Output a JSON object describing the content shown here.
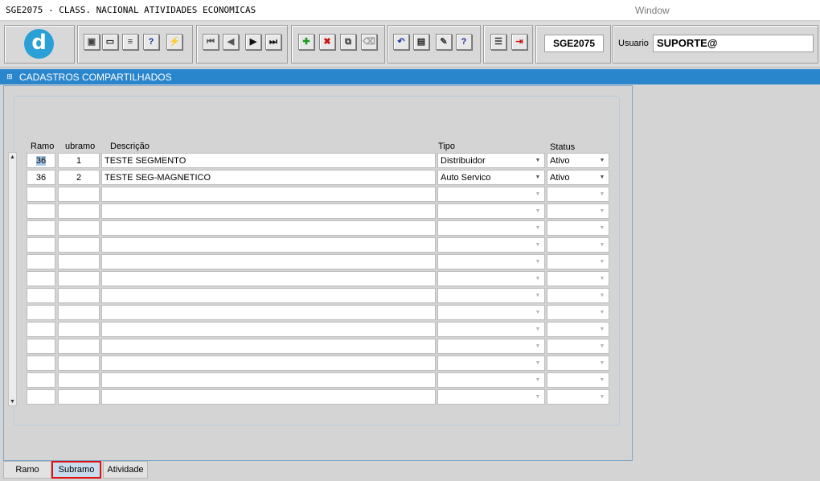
{
  "titlebar": {
    "app_title": "SGE2075 - CLASS. NACIONAL ATIVIDADES ECONOMICAS",
    "window_menu": "Window"
  },
  "toolbar": {
    "logo_glyph": "d",
    "screen_code": "SGE2075",
    "usuario_label": "Usuario",
    "usuario_value": "SUPORTE@",
    "buttons": [
      {
        "name": "save-icon",
        "glyph": "▣",
        "color": "#444444"
      },
      {
        "name": "window-icon",
        "glyph": "▭",
        "color": "#222222"
      },
      {
        "name": "print-icon",
        "glyph": "≡",
        "color": "#333333"
      },
      {
        "name": "query-icon",
        "glyph": "?",
        "color": "#1a2ea0"
      },
      {
        "name": "execute-query-icon",
        "glyph": "⚡",
        "color": "#1a2ea0"
      },
      {
        "name": "first-record-icon",
        "glyph": "⏮",
        "color": "#555555"
      },
      {
        "name": "previous-record-icon",
        "glyph": "◀",
        "color": "#555555"
      },
      {
        "name": "next-record-icon",
        "glyph": "▶",
        "color": "#111111"
      },
      {
        "name": "last-record-icon",
        "glyph": "⏭",
        "color": "#111111"
      },
      {
        "name": "insert-record-icon",
        "glyph": "✚",
        "color": "#1f9a1f"
      },
      {
        "name": "delete-record-icon",
        "glyph": "✖",
        "color": "#cc1010"
      },
      {
        "name": "duplicate-record-icon",
        "glyph": "⧉",
        "color": "#333333"
      },
      {
        "name": "clear-record-icon",
        "glyph": "⌫",
        "color": "#999999"
      },
      {
        "name": "undo-icon",
        "glyph": "↶",
        "color": "#1a2ea0"
      },
      {
        "name": "clipboard-icon",
        "glyph": "▤",
        "color": "#222222"
      },
      {
        "name": "tools-icon",
        "glyph": "✎",
        "color": "#333333"
      },
      {
        "name": "help-icon",
        "glyph": "?",
        "color": "#1a2ea0"
      },
      {
        "name": "menu-icon",
        "glyph": "☰",
        "color": "#333333"
      },
      {
        "name": "exit-icon",
        "glyph": "⇥",
        "color": "#cc1010"
      }
    ]
  },
  "section": {
    "icon": "section-icon",
    "title": "CADASTROS COMPARTILHADOS"
  },
  "grid": {
    "headers": {
      "ramo": "Ramo",
      "subramo": "ubramo",
      "descricao": "Descrição",
      "tipo": "Tipo",
      "status": "Status"
    },
    "rows": [
      {
        "ramo": "36",
        "subramo": "1",
        "descricao": "TESTE SEGMENTO",
        "tipo": "Distribuidor",
        "status": "Ativo"
      },
      {
        "ramo": "36",
        "subramo": "2",
        "descricao": "TESTE SEG-MAGNETICO",
        "tipo": "Auto Servico",
        "status": "Ativo"
      },
      {
        "ramo": "",
        "subramo": "",
        "descricao": "",
        "tipo": "",
        "status": ""
      },
      {
        "ramo": "",
        "subramo": "",
        "descricao": "",
        "tipo": "",
        "status": ""
      },
      {
        "ramo": "",
        "subramo": "",
        "descricao": "",
        "tipo": "",
        "status": ""
      },
      {
        "ramo": "",
        "subramo": "",
        "descricao": "",
        "tipo": "",
        "status": ""
      },
      {
        "ramo": "",
        "subramo": "",
        "descricao": "",
        "tipo": "",
        "status": ""
      },
      {
        "ramo": "",
        "subramo": "",
        "descricao": "",
        "tipo": "",
        "status": ""
      },
      {
        "ramo": "",
        "subramo": "",
        "descricao": "",
        "tipo": "",
        "status": ""
      },
      {
        "ramo": "",
        "subramo": "",
        "descricao": "",
        "tipo": "",
        "status": ""
      },
      {
        "ramo": "",
        "subramo": "",
        "descricao": "",
        "tipo": "",
        "status": ""
      },
      {
        "ramo": "",
        "subramo": "",
        "descricao": "",
        "tipo": "",
        "status": ""
      },
      {
        "ramo": "",
        "subramo": "",
        "descricao": "",
        "tipo": "",
        "status": ""
      },
      {
        "ramo": "",
        "subramo": "",
        "descricao": "",
        "tipo": "",
        "status": ""
      },
      {
        "ramo": "",
        "subramo": "",
        "descricao": "",
        "tipo": "",
        "status": ""
      }
    ]
  },
  "tabs": [
    {
      "label": "Ramo",
      "active": false
    },
    {
      "label": "Subramo",
      "active": true
    },
    {
      "label": "Atividade",
      "active": false
    }
  ],
  "colors": {
    "accent": "#2a86cc",
    "active_tab_border": "#e01010"
  }
}
